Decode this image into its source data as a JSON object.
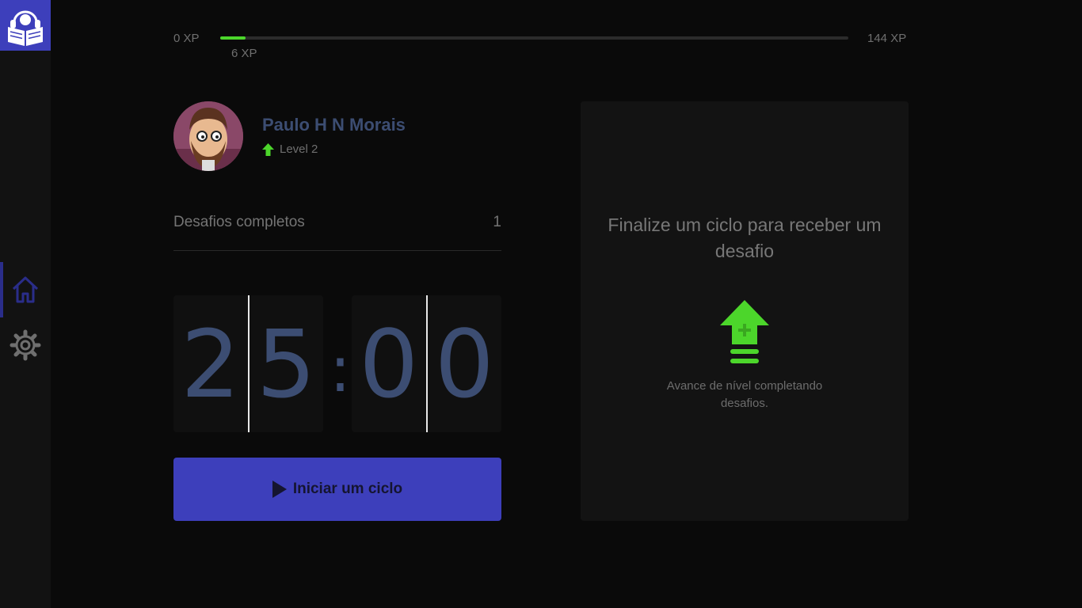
{
  "sidebar": {
    "logo_icon": "reader-headphones-icon",
    "items": [
      {
        "name": "home",
        "icon": "home-icon",
        "active": true
      },
      {
        "name": "settings",
        "icon": "gear-icon",
        "active": false
      }
    ]
  },
  "xp": {
    "min_label": "0 XP",
    "max_label": "144 XP",
    "current_label": "6 XP",
    "progress_percent": 4
  },
  "profile": {
    "name": "Paulo H N Morais",
    "level_label": "Level 2",
    "level_icon": "level-up-icon"
  },
  "challenges": {
    "label": "Desafios completos",
    "count": "1"
  },
  "countdown": {
    "minute_digits": [
      "2",
      "5"
    ],
    "separator": ":",
    "second_digits": [
      "0",
      "0"
    ]
  },
  "start_button": {
    "label": "Iniciar um ciclo",
    "icon": "play-icon"
  },
  "challenge_box": {
    "title": "Finalize um ciclo para receber um desafio",
    "description": "Avance de nível completando desafios.",
    "icon": "level-up-icon"
  },
  "colors": {
    "accent": "#3d3fbb",
    "green": "#4cd62b",
    "digit": "#3c4d72",
    "background": "#0a0a0a",
    "card": "#131313"
  }
}
